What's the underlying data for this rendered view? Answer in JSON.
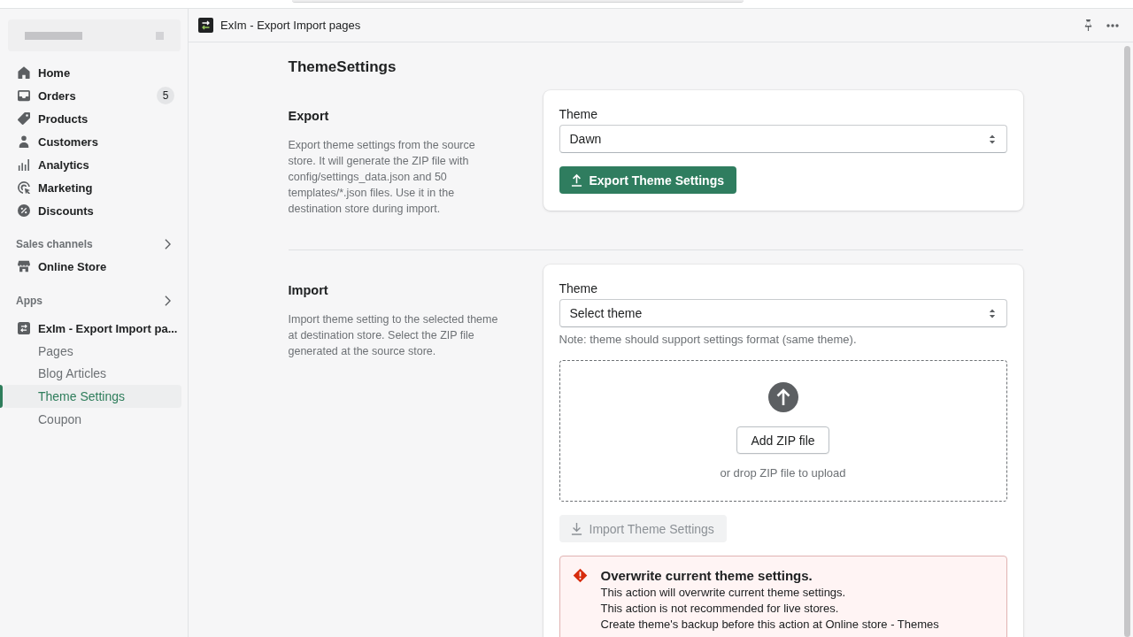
{
  "header": {
    "title": "ExIm - Export Import pages"
  },
  "sidebar": {
    "nav": [
      {
        "label": "Home",
        "selected": false
      },
      {
        "label": "Orders",
        "badge": "5",
        "selected": false
      },
      {
        "label": "Products",
        "selected": false
      },
      {
        "label": "Customers",
        "selected": false
      },
      {
        "label": "Analytics",
        "selected": false
      },
      {
        "label": "Marketing",
        "selected": false
      },
      {
        "label": "Discounts",
        "selected": false
      }
    ],
    "sales_channels": {
      "title": "Sales channels",
      "items": [
        {
          "label": "Online Store",
          "selected": false
        }
      ]
    },
    "apps": {
      "title": "Apps",
      "items": [
        {
          "label": "ExIm - Export Import pa...",
          "selected": false,
          "children": [
            {
              "label": "Pages",
              "selected": false
            },
            {
              "label": "Blog Articles",
              "selected": false
            },
            {
              "label": "Theme Settings",
              "selected": true
            },
            {
              "label": "Coupon",
              "selected": false
            }
          ]
        }
      ]
    }
  },
  "page": {
    "title": "ThemeSettings",
    "sections": [
      {
        "kind": "export",
        "heading": "Export",
        "description": "Export theme settings from the source store. It will generate the ZIP file with config/settings_data.json and 50 templates/*.json files. Use it in the destination store during import.",
        "field": {
          "label": "Theme",
          "value": "Dawn"
        },
        "button": {
          "label": "Export Theme Settings",
          "disabled": false
        }
      },
      {
        "kind": "import",
        "heading": "Import",
        "description": "Import theme setting to the selected theme at destination store. Select the ZIP file generated at the source store.",
        "field": {
          "label": "Theme",
          "value": "Select theme"
        },
        "note": "Note: theme should support settings format (same theme).",
        "dropzone": {
          "button": "Add ZIP file",
          "hint": "or drop ZIP file to upload"
        },
        "button": {
          "label": "Import Theme Settings",
          "disabled": true
        },
        "banner": {
          "title": "Overwrite current theme settings.",
          "lines": [
            "This action will overwrite current theme settings.",
            "This action is not recommended for live stores.",
            "Create theme's backup before this action at Online store - Themes"
          ]
        }
      }
    ]
  }
}
